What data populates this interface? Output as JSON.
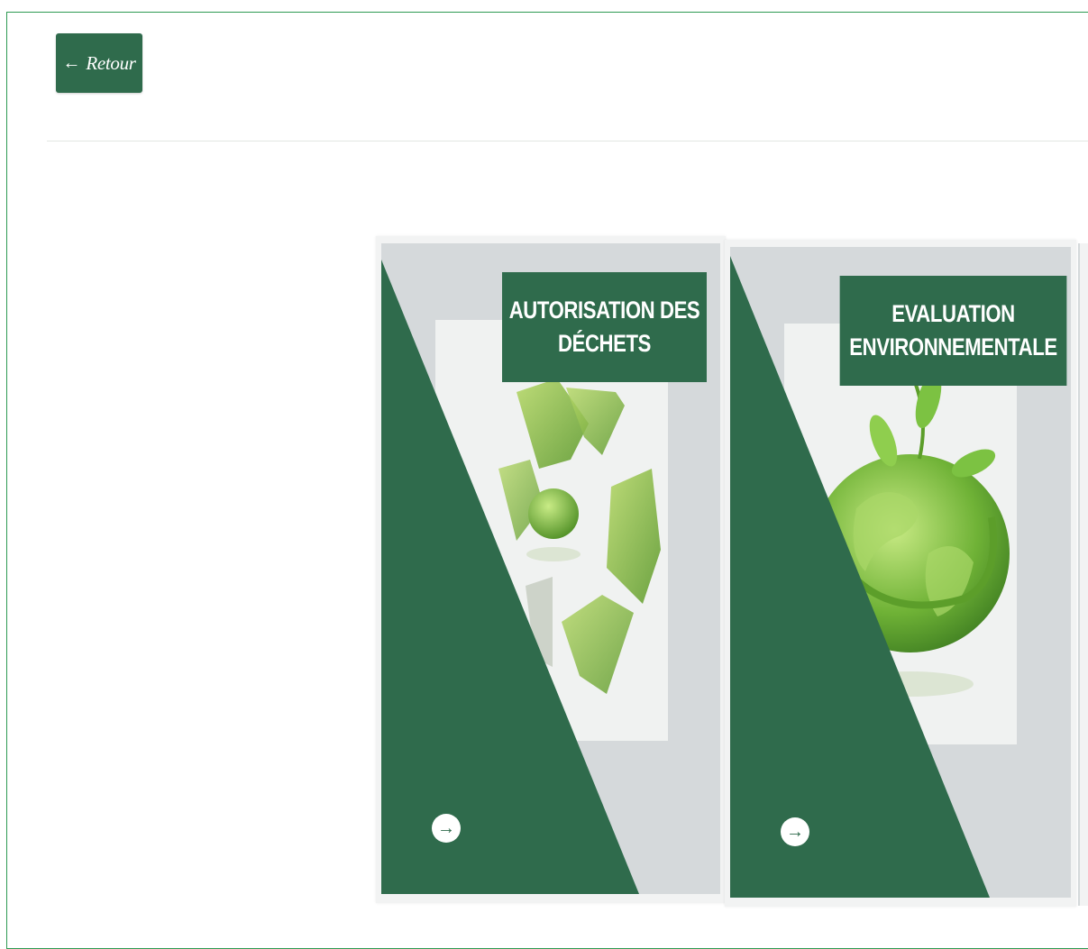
{
  "header": {
    "back_label": "Retour",
    "back_icon": "arrow-left-icon"
  },
  "cards": [
    {
      "title": "AUTORISATION DES DÉCHETS",
      "image": "recycling-globe-illustration",
      "action_icon": "arrow-right-circle-icon"
    },
    {
      "title": "EVALUATION ENVIRONNEMENTALE",
      "image": "green-earth-leaves-illustration",
      "action_icon": "arrow-right-circle-icon"
    }
  ],
  "colors": {
    "brand_green": "#2f6b4c",
    "frame_border": "#2e9a52",
    "card_background": "#d5d9db",
    "leaf_green": "#7cc242"
  }
}
